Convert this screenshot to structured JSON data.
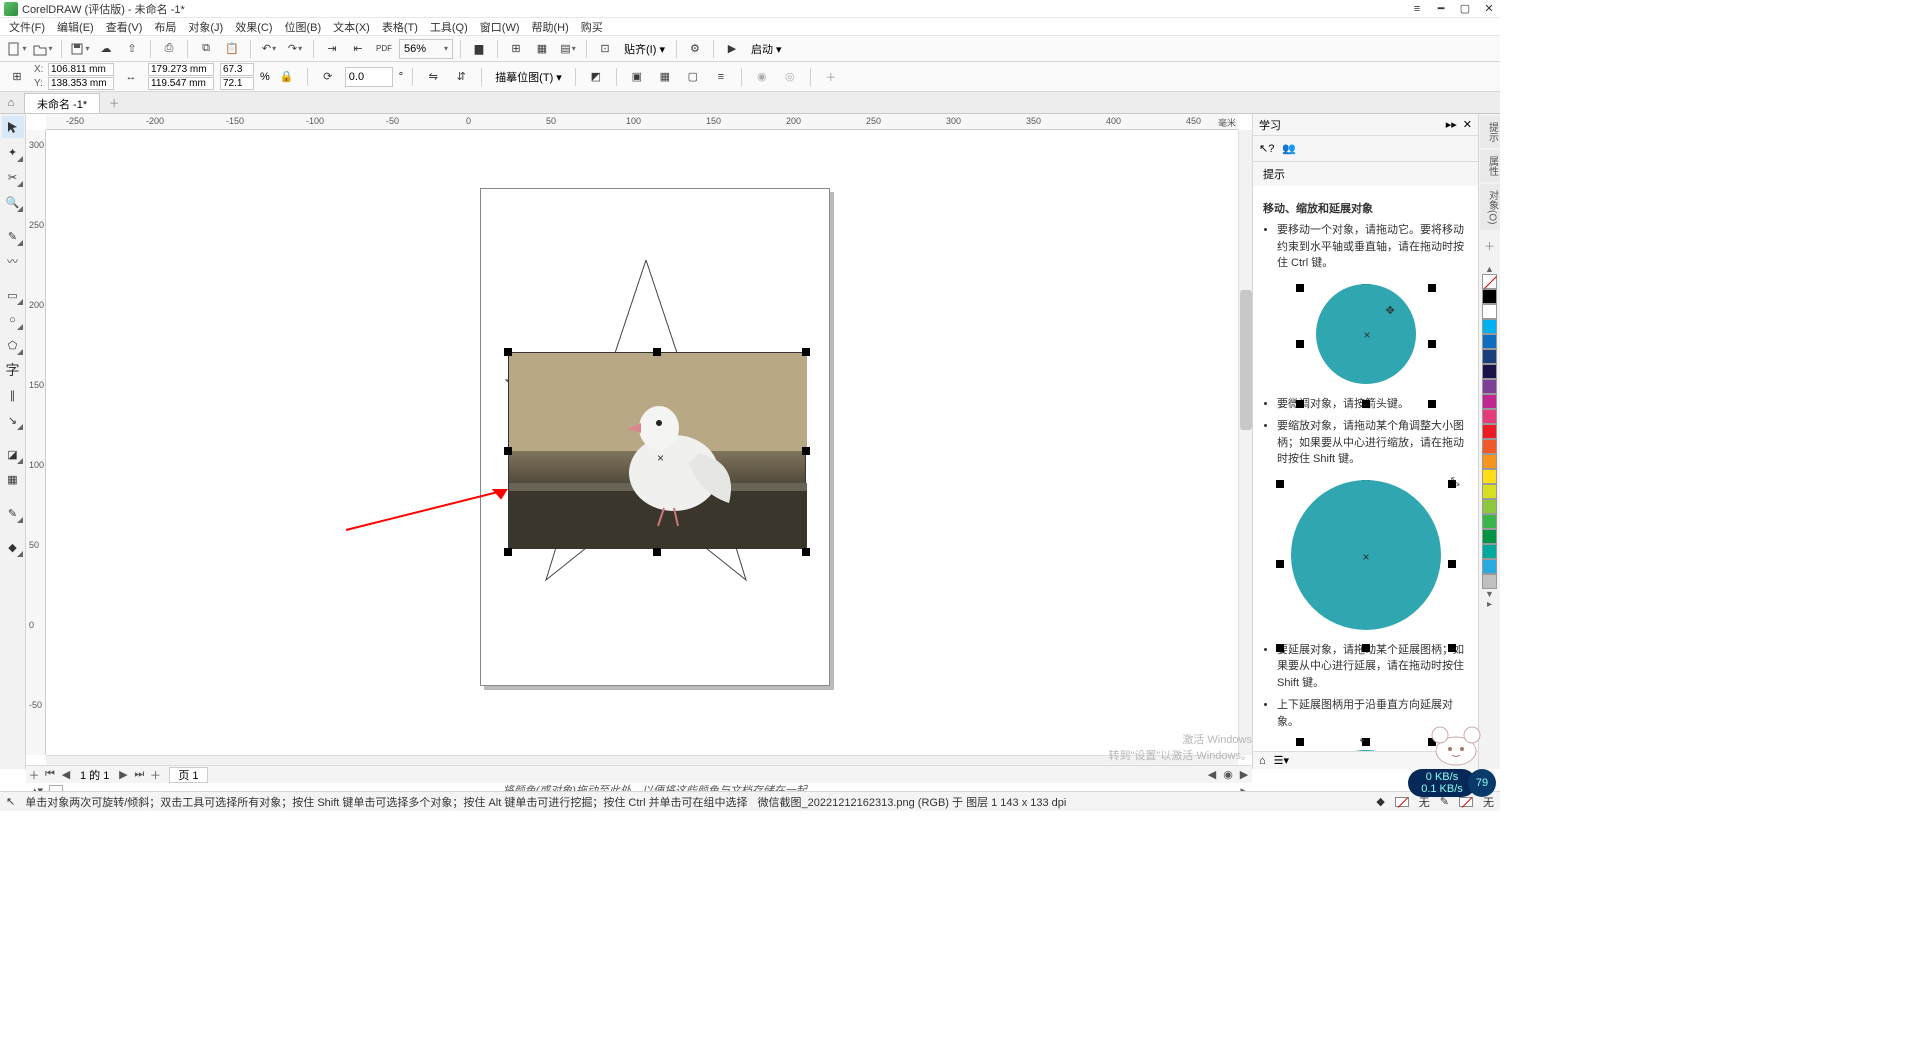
{
  "title": "CorelDRAW (评估版) - 未命名 -1*",
  "menus": [
    "文件(F)",
    "编辑(E)",
    "查看(V)",
    "布局",
    "对象(J)",
    "效果(C)",
    "位图(B)",
    "文本(X)",
    "表格(T)",
    "工具(Q)",
    "窗口(W)",
    "帮助(H)",
    "购买"
  ],
  "toolbar": {
    "zoom": "56%",
    "align_label": "贴齐(I)",
    "launch_label": "启动"
  },
  "propbar": {
    "x_label": "X:",
    "y_label": "Y:",
    "x": "106.811 mm",
    "y": "138.353 mm",
    "w": "179.273 mm",
    "h": "119.547 mm",
    "sx": "67.3",
    "sy": "72.1",
    "pct": "%",
    "rot": "0.0",
    "trace_label": "描摹位图(T)"
  },
  "doc_tab": "未命名 -1*",
  "ruler_unit": "毫米",
  "ruler_h": [
    "-250",
    "-200",
    "-150",
    "-100",
    "-50",
    "0",
    "50",
    "100",
    "150",
    "200",
    "250",
    "300",
    "350",
    "400",
    "450"
  ],
  "ruler_v": [
    "-50",
    "0",
    "50",
    "100",
    "150",
    "200",
    "250",
    "300"
  ],
  "learn": {
    "title": "学习",
    "hints": "提示",
    "h": "移动、缩放和延展对象",
    "li1": "要移动一个对象，请拖动它。要将移动约束到水平轴或垂直轴，请在拖动时按住 Ctrl 键。",
    "li2": "要微调对象，请按箭头键。",
    "li3": "要缩放对象，请拖动某个角调整大小图柄；如果要从中心进行缩放，请在拖动时按住 Shift 键。",
    "li4": "要延展对象，请拖动某个延展图柄；如果要从中心进行延展，请在拖动时按住 Shift 键。",
    "li5": "上下延展图柄用于沿垂直方向延展对象。"
  },
  "dock_tabs": [
    "提示",
    "属性",
    "对象(O)"
  ],
  "colors": [
    "#000000",
    "#ffffff",
    "#00b0f0",
    "#0f6dbf",
    "#1a3f7a",
    "#1b124a",
    "#7e3f98",
    "#c02790",
    "#e63b7a",
    "#ed1c24",
    "#f15a29",
    "#f7941d",
    "#ffde17",
    "#d7df23",
    "#8dc63f",
    "#39b54a",
    "#009444",
    "#00a99d",
    "#27aae1",
    "#c0c0c0"
  ],
  "pager": {
    "info": "1 的 1",
    "page": "页 1"
  },
  "colorline_hint": "将颜色(或对象)拖动至此处，以便将这些颜色与文档存储在一起",
  "status": {
    "hint": "单击对象两次可旋转/倾斜；双击工具可选择所有对象；按住 Shift 键单击可选择多个对象；按住 Alt 键单击可进行挖掘；按住 Ctrl 并单击可在组中选择",
    "obj": "微信截图_20221212162313.png (RGB) 于 图层 1 143 x 133 dpi",
    "none": "无"
  },
  "watermark": {
    "l1": "激活 Windows",
    "l2": "转到\"设置\"以激活 Windows。"
  },
  "perf": {
    "a": "0 KB/s",
    "b": "0.1 KB/s",
    "c": "79"
  }
}
